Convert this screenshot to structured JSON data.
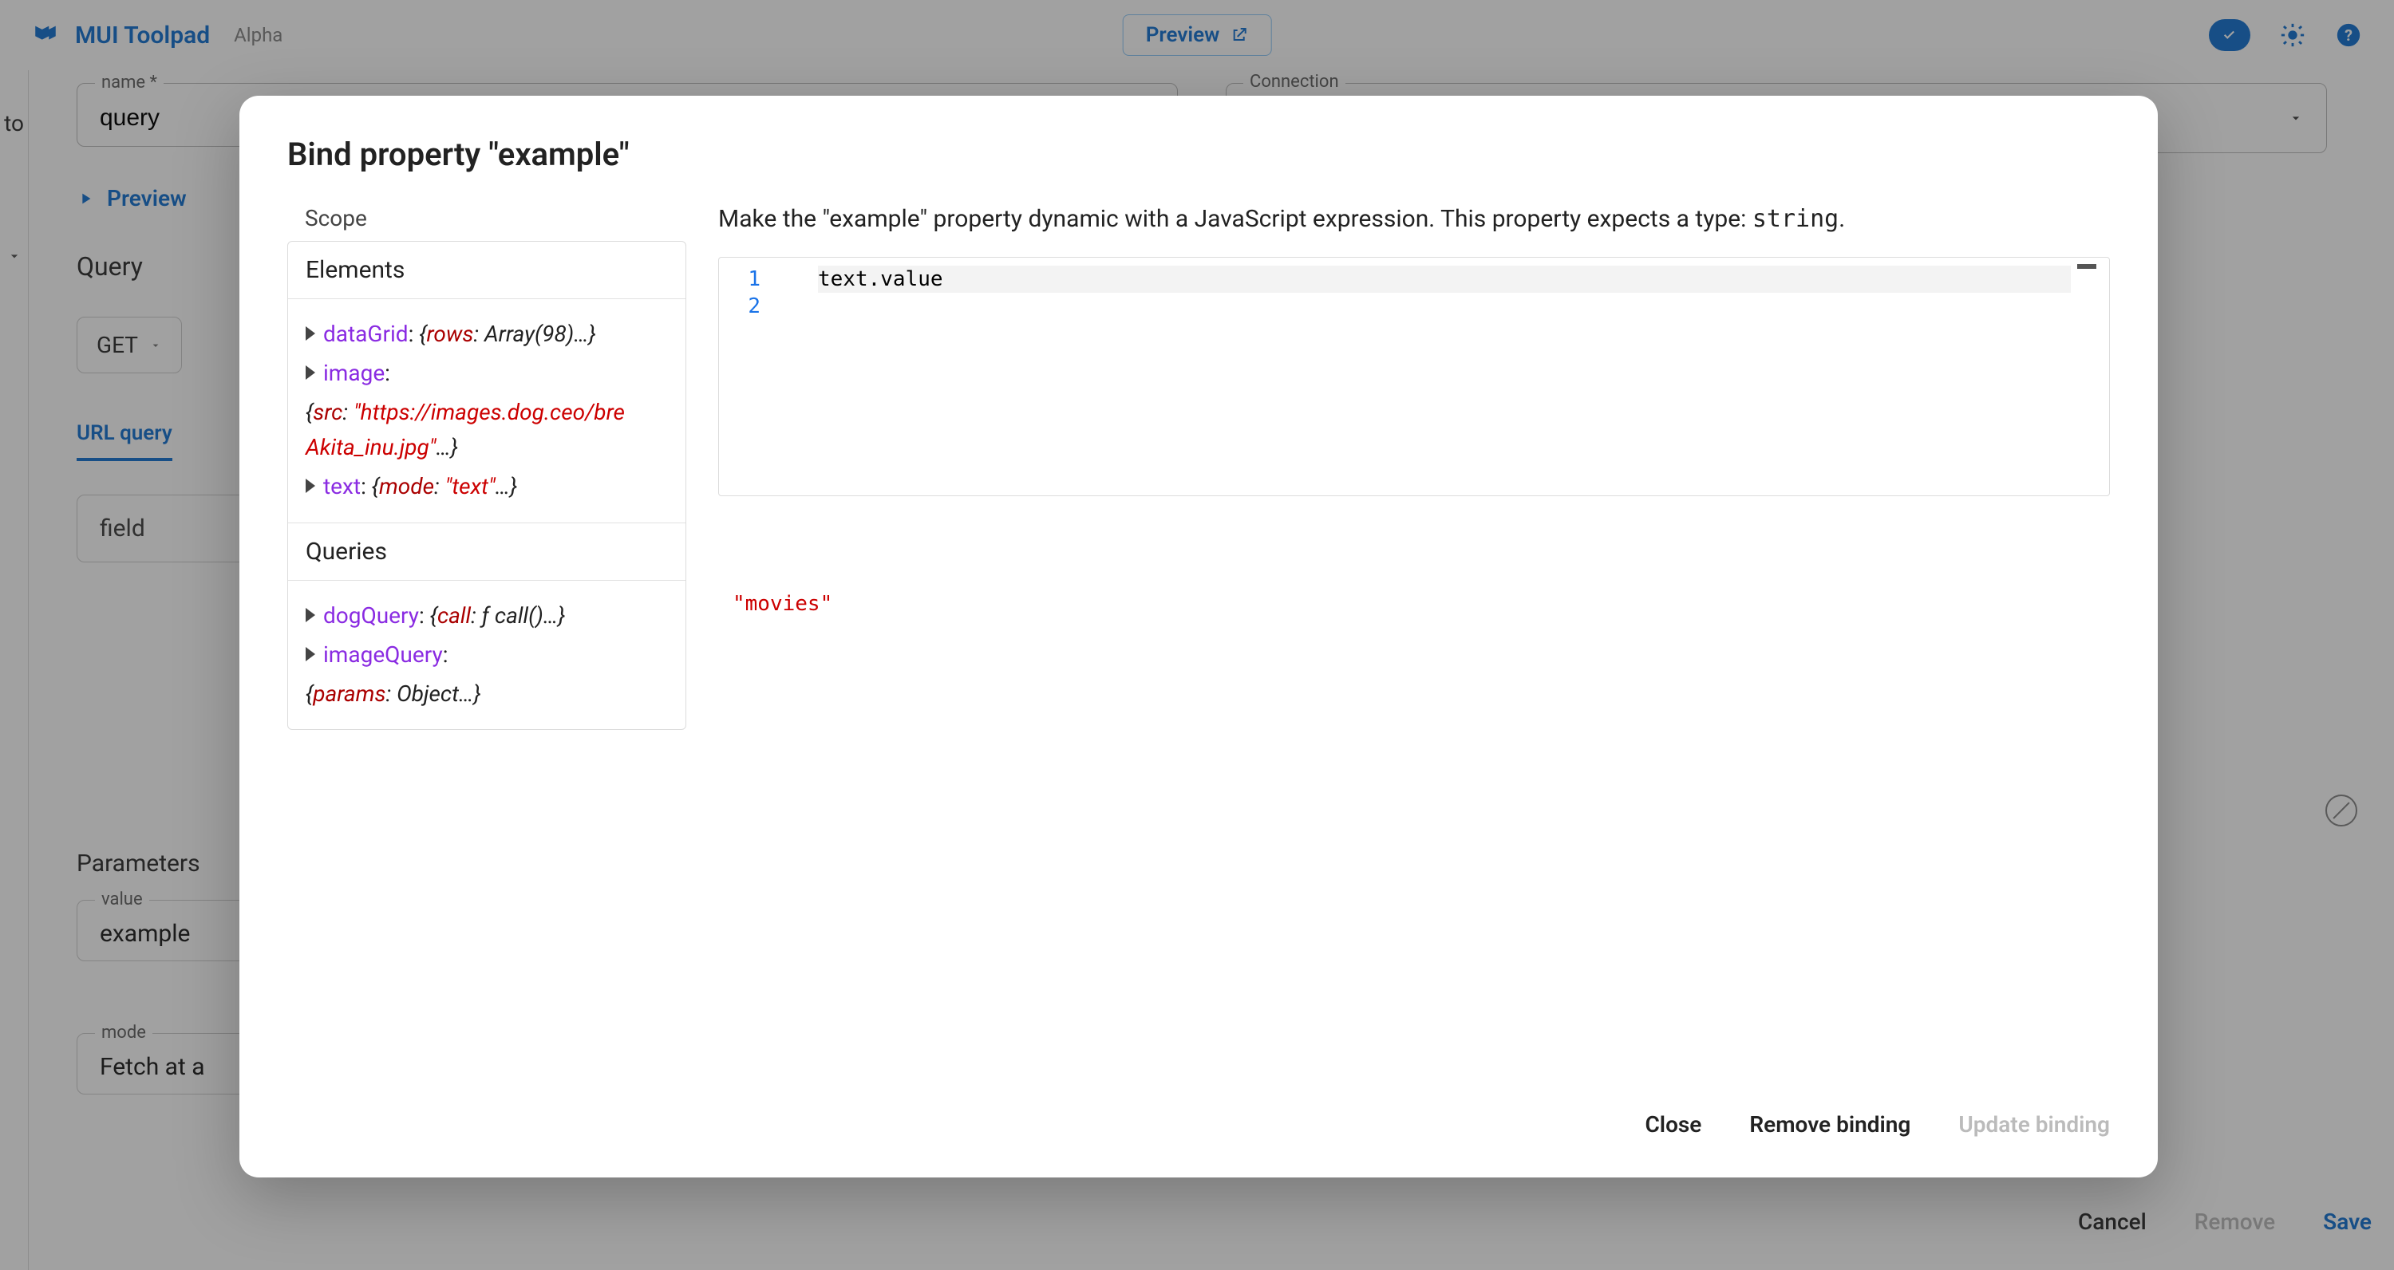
{
  "topbar": {
    "app_title": "MUI Toolpad",
    "stage": "Alpha",
    "preview_label": "Preview"
  },
  "left": {
    "text_stub": "to"
  },
  "form": {
    "name_label": "name *",
    "name_value": "query",
    "connection_label": "Connection",
    "preview_link": "Preview",
    "query_heading": "Query",
    "method": "GET",
    "tab_url_query": "URL query",
    "field_value": "field",
    "parameters_heading": "Parameters",
    "param_value_label": "value",
    "param_value": "example",
    "param_mode_label": "mode",
    "param_mode": "Fetch at a"
  },
  "footer_bg": {
    "cancel": "Cancel",
    "remove": "Remove",
    "save": "Save"
  },
  "modal": {
    "title": "Bind property \"example\"",
    "scope_label": "Scope",
    "elements_heading": "Elements",
    "queries_heading": "Queries",
    "elements": {
      "dataGrid": {
        "name": "dataGrid",
        "rows": "Array(98)"
      },
      "image": {
        "name": "image",
        "src": "\"https://images.dog.ceo/bre\nAkita_inu.jpg\""
      },
      "text": {
        "name": "text",
        "mode": "\"text\""
      }
    },
    "queries": {
      "dogQuery": {
        "name": "dogQuery",
        "call": "ƒ call()"
      },
      "imageQuery": {
        "name": "imageQuery",
        "params": "Object"
      }
    },
    "description_pre": "Make the \"example\" property dynamic with a JavaScript expression. This property expects a type: ",
    "description_type": "string",
    "description_post": ".",
    "code_line_1": "text.value",
    "result": "\"movies\"",
    "btn_close": "Close",
    "btn_remove": "Remove binding",
    "btn_update": "Update binding"
  }
}
